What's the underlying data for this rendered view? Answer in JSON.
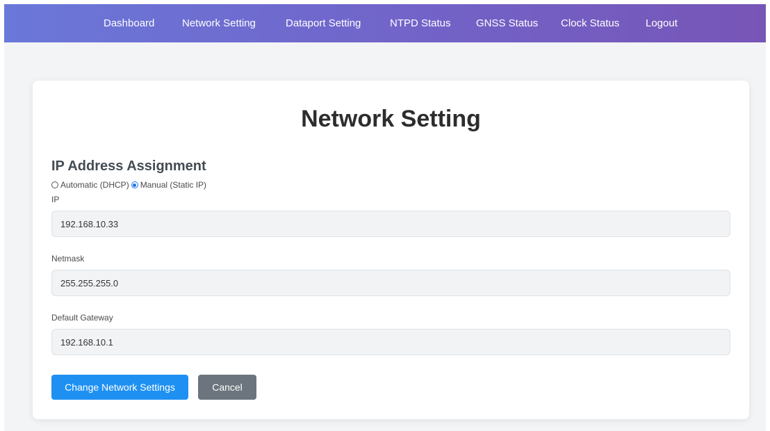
{
  "nav": {
    "items": [
      {
        "label": "Dashboard"
      },
      {
        "label": "Network Setting"
      },
      {
        "label": "Dataport Setting"
      },
      {
        "label": "NTPD Status"
      },
      {
        "label": "GNSS Status"
      },
      {
        "label": "Clock Status"
      },
      {
        "label": "Logout"
      }
    ]
  },
  "main": {
    "title": "Network Setting",
    "section_title": "IP Address Assignment",
    "assignment": {
      "options": [
        {
          "label": "Automatic (DHCP)",
          "checked": false
        },
        {
          "label": "Manual (Static IP)",
          "checked": true
        }
      ]
    },
    "fields": {
      "ip": {
        "label": "IP",
        "value": "192.168.10.33"
      },
      "netmask": {
        "label": "Netmask",
        "value": "255.255.255.0"
      },
      "gateway": {
        "label": "Default Gateway",
        "value": "192.168.10.1"
      }
    },
    "buttons": {
      "submit": "Change Network Settings",
      "cancel": "Cancel"
    }
  },
  "colors": {
    "nav_gradient_start": "#6a78d9",
    "nav_gradient_end": "#7755b7",
    "primary_button": "#1e90f2",
    "secondary_button": "#6c757d"
  }
}
